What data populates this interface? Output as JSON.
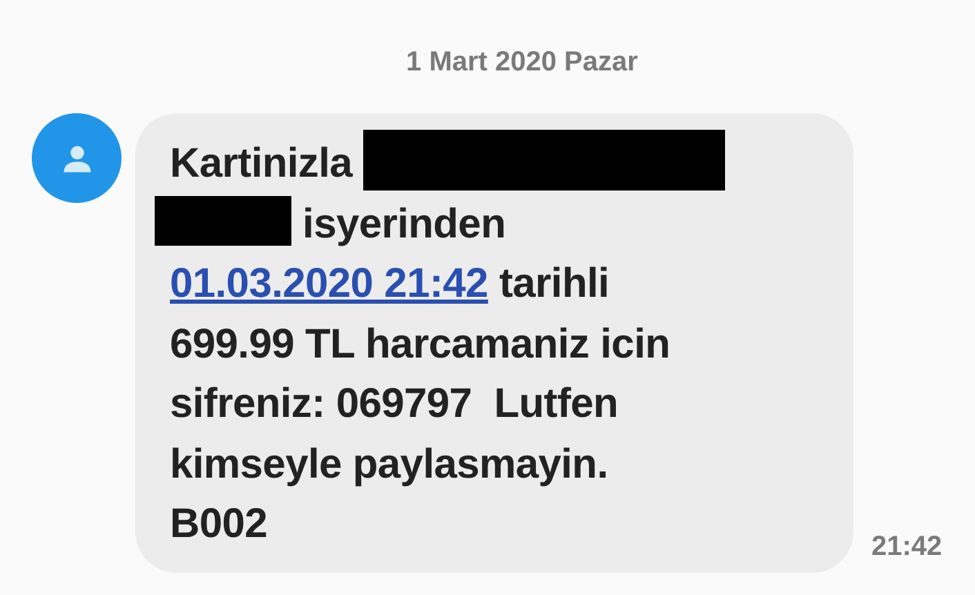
{
  "date_header": "1 Mart 2020 Pazar",
  "message": {
    "lines": [
      [
        {
          "kind": "text",
          "text": "Kartinizla "
        },
        {
          "kind": "redacted"
        }
      ],
      [
        {
          "kind": "redacted"
        },
        {
          "kind": "text",
          "text": " isyerinden"
        }
      ],
      [
        {
          "kind": "link",
          "text": "01.03.2020 21:42"
        },
        {
          "kind": "text",
          "text": " tarihli"
        }
      ],
      [
        {
          "kind": "text",
          "text": "699.99 TL harcamaniz icin"
        }
      ],
      [
        {
          "kind": "text",
          "text": "sifreniz: 069797  Lutfen"
        }
      ],
      [
        {
          "kind": "text",
          "text": "kimseyle paylasmayin."
        }
      ],
      [
        {
          "kind": "text",
          "text": "B002"
        }
      ]
    ],
    "time": "21:42"
  }
}
